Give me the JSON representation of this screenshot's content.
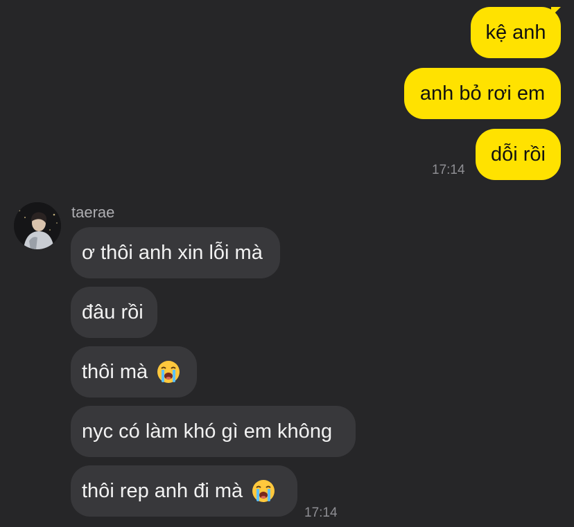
{
  "outgoing": [
    {
      "text": "kệ anh"
    },
    {
      "text": "anh bỏ rơi em"
    },
    {
      "text": "dỗi rồi"
    }
  ],
  "outgoing_time": "17:14",
  "sender": {
    "name": "taerae",
    "avatar": "avatar-photo"
  },
  "incoming": [
    {
      "text": "ơ thôi anh xin lỗi mà"
    },
    {
      "text": "đâu rồi"
    },
    {
      "text": "thôi mà",
      "emoji": "loudly-crying-face-icon"
    },
    {
      "text": "nyc có làm khó gì em không"
    },
    {
      "text": "thôi rep anh đi mà",
      "emoji": "loudly-crying-face-icon"
    }
  ],
  "incoming_time": "17:14",
  "colors": {
    "background": "#262628",
    "outgoing_bubble": "#FFE200",
    "incoming_bubble": "#38383B",
    "timestamp": "#8E8E93"
  }
}
